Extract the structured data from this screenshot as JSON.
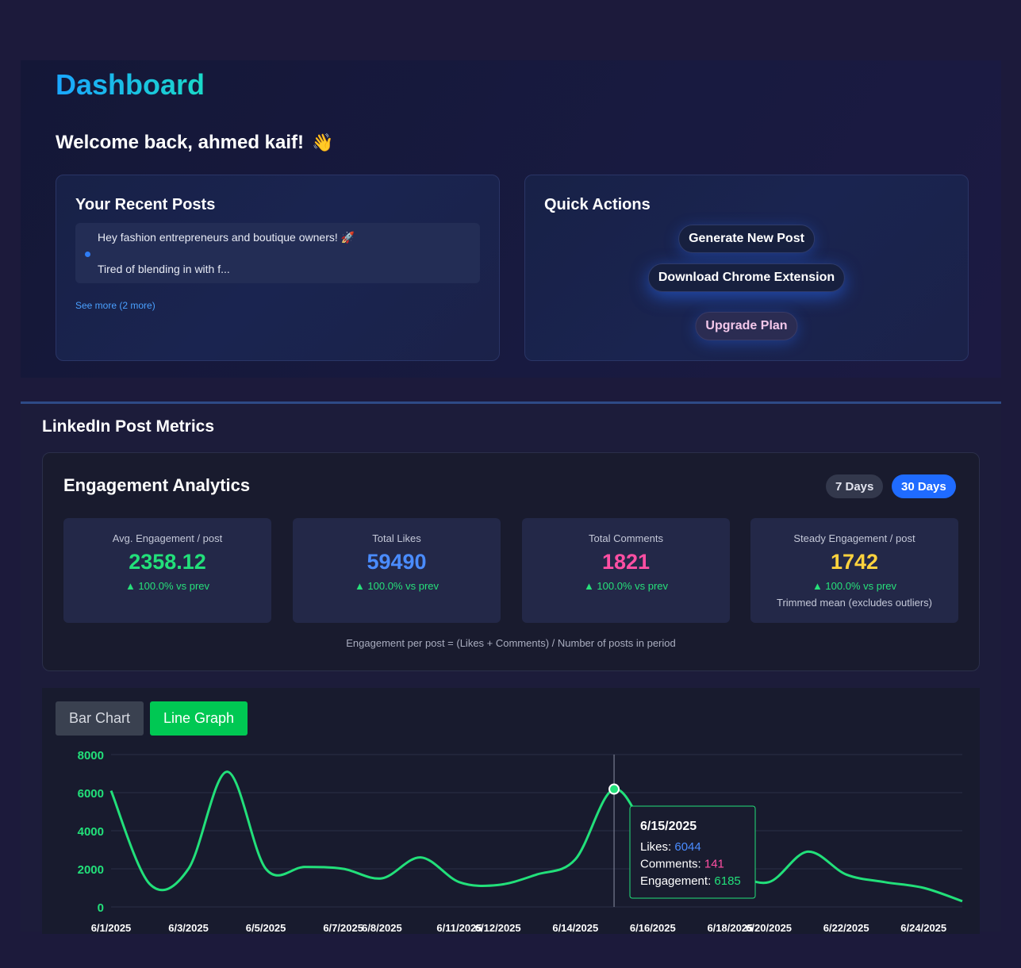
{
  "header": {
    "title": "Dashboard",
    "welcome": "Welcome back, ahmed kaif!",
    "wave_emoji": "👋"
  },
  "recent_posts": {
    "title": "Your Recent Posts",
    "items": [
      {
        "line1": "Hey fashion entrepreneurs and boutique owners! 🚀",
        "line2": "Tired of blending in with f..."
      }
    ],
    "see_more": "See more (2 more)"
  },
  "quick_actions": {
    "title": "Quick Actions",
    "generate": "Generate New Post",
    "download": "Download Chrome Extension",
    "upgrade": "Upgrade Plan"
  },
  "metrics": {
    "title": "LinkedIn Post Metrics",
    "analytics_title": "Engagement Analytics",
    "range_7": "7 Days",
    "range_30": "30 Days",
    "selected_range": "30 Days",
    "stats": [
      {
        "label": "Avg. Engagement / post",
        "value": "2358.12",
        "change": "▲ 100.0% vs prev",
        "color": "#22e07a"
      },
      {
        "label": "Total Likes",
        "value": "59490",
        "change": "▲ 100.0% vs prev",
        "color": "#4a8cff"
      },
      {
        "label": "Total Comments",
        "value": "1821",
        "change": "▲ 100.0% vs prev",
        "color": "#ff4fa3"
      },
      {
        "label": "Steady Engagement / post",
        "value": "1742",
        "change": "▲ 100.0% vs prev",
        "note": "Trimmed mean (excludes outliers)",
        "color": "#ffd33d"
      }
    ],
    "formula": "Engagement per post = (Likes + Comments) / Number of posts in period"
  },
  "chart_tabs": {
    "bar": "Bar Chart",
    "line": "Line Graph",
    "active": "Line Graph"
  },
  "chart_data": {
    "type": "line",
    "x": [
      "6/1/2025",
      "6/2/2025",
      "6/3/2025",
      "6/4/2025",
      "6/5/2025",
      "6/6/2025",
      "6/7/2025",
      "6/8/2025",
      "6/9/2025",
      "6/11/2025",
      "6/12/2025",
      "6/13/2025",
      "6/14/2025",
      "6/15/2025",
      "6/16/2025",
      "6/17/2025",
      "6/18/2025",
      "6/20/2025",
      "6/21/2025",
      "6/22/2025",
      "6/23/2025",
      "6/24/2025",
      "6/25/2025"
    ],
    "x_ticks": [
      "6/1/2025",
      "6/3/2025",
      "6/5/2025",
      "6/7/2025",
      "6/8/2025",
      "6/11/2025",
      "6/12/2025",
      "6/14/2025",
      "6/16/2025",
      "6/18/2025",
      "6/20/2025",
      "6/22/2025",
      "6/24/2025"
    ],
    "series": [
      {
        "values": [
          6100,
          1200,
          2000,
          7100,
          2000,
          2100,
          2000,
          1500,
          2600,
          1300,
          1150,
          1700,
          2500,
          6185,
          3500,
          2200,
          1800,
          1300,
          2900,
          1700,
          1300,
          1000,
          300
        ],
        "color": "#22e07a"
      }
    ],
    "y_ticks": [
      "0",
      "2000",
      "4000",
      "6000",
      "8000"
    ],
    "ylim": [
      0,
      8000
    ],
    "grid": true,
    "tooltip": {
      "date": "6/15/2025",
      "likes_label": "Likes:",
      "likes": "6044",
      "comments_label": "Comments:",
      "comments": "141",
      "engagement_label": "Engagement:",
      "engagement": "6185"
    }
  }
}
